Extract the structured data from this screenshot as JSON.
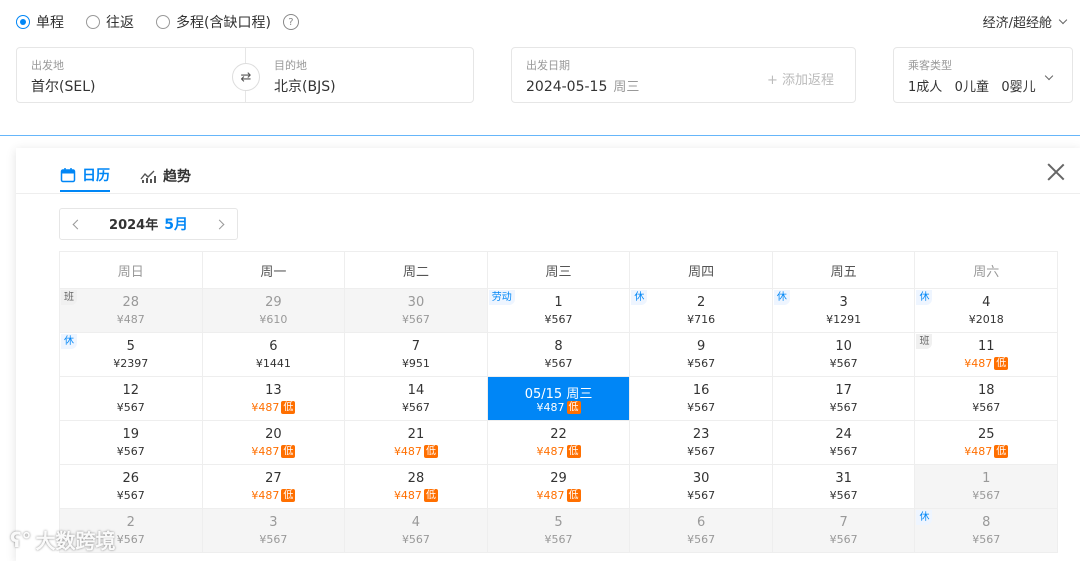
{
  "trip_types": [
    {
      "label": "单程",
      "checked": true
    },
    {
      "label": "往返",
      "checked": false
    },
    {
      "label": "多程(含缺口程)",
      "checked": false
    }
  ],
  "help_icon": "?",
  "cabin": "经济/超经舱",
  "route": {
    "from_label": "出发地",
    "from_value": "首尔(SEL)",
    "to_label": "目的地",
    "to_value": "北京(BJS)",
    "swap_icon": "⇄"
  },
  "date": {
    "label": "出发日期",
    "value": "2024-05-15",
    "week": "周三",
    "add_return": "+ 添加返程"
  },
  "passengers": {
    "label": "乘客类型",
    "value": "1成人   0儿童   0婴儿"
  },
  "tabs": [
    {
      "label": "日历",
      "icon": "calendar-icon"
    },
    {
      "label": "趋势",
      "icon": "trend-icon"
    }
  ],
  "month": {
    "year": "2024年",
    "month": "5月"
  },
  "weekdays": [
    "周日",
    "周一",
    "周二",
    "周三",
    "周四",
    "周五",
    "周六"
  ],
  "calendar_rows": [
    [
      {
        "d": "28",
        "p": "¥487",
        "other": true,
        "tag": "班",
        "tagtype": "ban"
      },
      {
        "d": "29",
        "p": "¥610",
        "other": true
      },
      {
        "d": "30",
        "p": "¥567",
        "other": true
      },
      {
        "d": "1",
        "p": "¥567",
        "tag": "劳动"
      },
      {
        "d": "2",
        "p": "¥716",
        "tag": "休"
      },
      {
        "d": "3",
        "p": "¥1291",
        "tag": "休"
      },
      {
        "d": "4",
        "p": "¥2018",
        "tag": "休"
      }
    ],
    [
      {
        "d": "5",
        "p": "¥2397",
        "tag": "休"
      },
      {
        "d": "6",
        "p": "¥1441"
      },
      {
        "d": "7",
        "p": "¥951"
      },
      {
        "d": "8",
        "p": "¥567"
      },
      {
        "d": "9",
        "p": "¥567"
      },
      {
        "d": "10",
        "p": "¥567"
      },
      {
        "d": "11",
        "p": "¥487",
        "low": true,
        "tag": "班",
        "tagtype": "ban"
      }
    ],
    [
      {
        "d": "12",
        "p": "¥567"
      },
      {
        "d": "13",
        "p": "¥487",
        "low": true
      },
      {
        "d": "14",
        "p": "¥567"
      },
      {
        "d": "05/15 周三",
        "p": "¥487",
        "low": true,
        "sel": true
      },
      {
        "d": "16",
        "p": "¥567"
      },
      {
        "d": "17",
        "p": "¥567"
      },
      {
        "d": "18",
        "p": "¥567"
      }
    ],
    [
      {
        "d": "19",
        "p": "¥567"
      },
      {
        "d": "20",
        "p": "¥487",
        "low": true
      },
      {
        "d": "21",
        "p": "¥487",
        "low": true
      },
      {
        "d": "22",
        "p": "¥487",
        "low": true
      },
      {
        "d": "23",
        "p": "¥567"
      },
      {
        "d": "24",
        "p": "¥567"
      },
      {
        "d": "25",
        "p": "¥487",
        "low": true
      }
    ],
    [
      {
        "d": "26",
        "p": "¥567"
      },
      {
        "d": "27",
        "p": "¥487",
        "low": true
      },
      {
        "d": "28",
        "p": "¥487",
        "low": true
      },
      {
        "d": "29",
        "p": "¥487",
        "low": true
      },
      {
        "d": "30",
        "p": "¥567"
      },
      {
        "d": "31",
        "p": "¥567"
      },
      {
        "d": "1",
        "p": "¥567",
        "other": true
      }
    ],
    [
      {
        "d": "2",
        "p": "¥567",
        "other": true
      },
      {
        "d": "3",
        "p": "¥567",
        "other": true
      },
      {
        "d": "4",
        "p": "¥567",
        "other": true
      },
      {
        "d": "5",
        "p": "¥567",
        "other": true
      },
      {
        "d": "6",
        "p": "¥567",
        "other": true
      },
      {
        "d": "7",
        "p": "¥567",
        "other": true
      },
      {
        "d": "8",
        "p": "¥567",
        "other": true,
        "tag": "休"
      }
    ]
  ],
  "low_label": "低",
  "watermark": "大数跨境",
  "colors": {
    "accent": "#0086f6",
    "low": "#ff6f00"
  }
}
